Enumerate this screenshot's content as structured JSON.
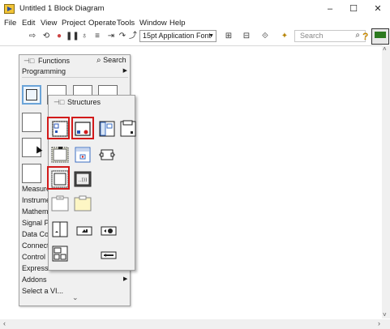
{
  "window": {
    "title": "Untitled 1 Block Diagram",
    "minimize": "–",
    "maximize": "☐",
    "close": "✕"
  },
  "menu": [
    "File",
    "Edit",
    "View",
    "Project",
    "Operate",
    "Tools",
    "Window",
    "Help"
  ],
  "toolbar": {
    "font_value": "15pt Application Font",
    "search_placeholder": "Search",
    "help_glyph": "?"
  },
  "functions_palette": {
    "title": "Functions",
    "search_label": "Search",
    "category": "Programming",
    "list_items": [
      "Measure",
      "Instrume",
      "Mathem",
      "Signal P",
      "Data Co",
      "Connect",
      "Control",
      "Express",
      "Addons",
      "Select a VI..."
    ],
    "more_glyph": "⌄"
  },
  "structures_palette": {
    "title": "Structures",
    "highlighted_items": [
      "For Loop",
      "While Loop",
      "Flat Sequence"
    ]
  },
  "colors": {
    "highlight_red": "#d21a1a",
    "selected_blue": "#6ba4d8",
    "palette_bg": "#f0f0f0"
  }
}
